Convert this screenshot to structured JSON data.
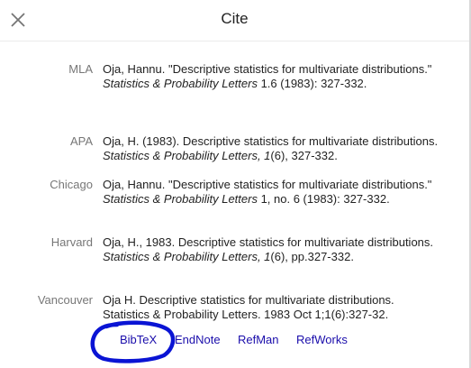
{
  "dialog": {
    "title": "Cite",
    "close_icon": "close-icon"
  },
  "citations": [
    {
      "style": "MLA",
      "parts": [
        {
          "t": "Oja, Hannu. \"Descriptive statistics for multivariate distributions.\" ",
          "i": false
        },
        {
          "t": "Statistics & Probability Letters",
          "i": true
        },
        {
          "t": " 1.6 (1983): 327-332.",
          "i": false
        }
      ]
    },
    {
      "style": "APA",
      "parts": [
        {
          "t": "Oja, H. (1983). Descriptive statistics for multivariate distributions. ",
          "i": false
        },
        {
          "t": "Statistics & Probability Letters, 1",
          "i": true
        },
        {
          "t": "(6), 327-332.",
          "i": false
        }
      ]
    },
    {
      "style": "Chicago",
      "parts": [
        {
          "t": "Oja, Hannu. \"Descriptive statistics for multivariate distributions.\" ",
          "i": false
        },
        {
          "t": "Statistics & Probability Letters",
          "i": true
        },
        {
          "t": " 1, no. 6 (1983): 327-332.",
          "i": false
        }
      ]
    },
    {
      "style": "Harvard",
      "parts": [
        {
          "t": "Oja, H., 1983. Descriptive statistics for multivariate distributions. ",
          "i": false
        },
        {
          "t": "Statistics & Probability Letters, 1",
          "i": true
        },
        {
          "t": "(6), pp.327-332.",
          "i": false
        }
      ]
    },
    {
      "style": "Vancouver",
      "parts": [
        {
          "t": "Oja H. Descriptive statistics for multivariate distributions. Statistics & Probability Letters. 1983 Oct 1;1(6):327-32.",
          "i": false
        }
      ]
    }
  ],
  "export_links": {
    "bibtex": "BibTeX",
    "endnote": "EndNote",
    "refman": "RefMan",
    "refworks": "RefWorks"
  },
  "colors": {
    "link": "#1a0dab",
    "annotation": "#0a14d4"
  }
}
